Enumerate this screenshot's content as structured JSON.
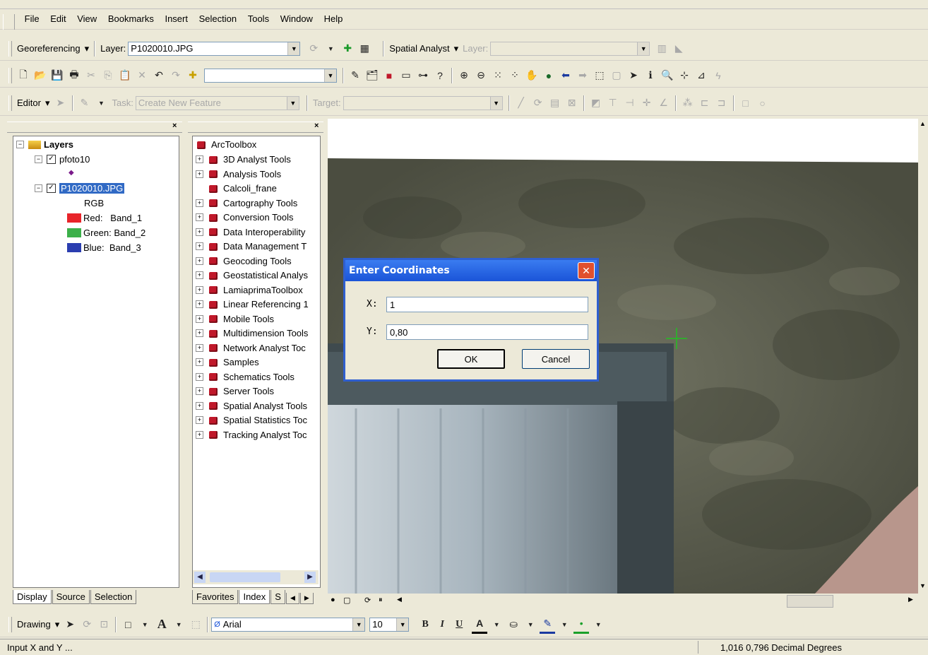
{
  "menu": [
    "File",
    "Edit",
    "View",
    "Bookmarks",
    "Insert",
    "Selection",
    "Tools",
    "Window",
    "Help"
  ],
  "georef_toolbar": {
    "georef_label": "Georeferencing",
    "layer_label": "Layer:",
    "layer_value": "P1020010.JPG",
    "spatial_label": "Spatial Analyst",
    "layer2_label": "Layer:"
  },
  "editor_toolbar": {
    "editor_label": "Editor",
    "task_label": "Task:",
    "task_value": "Create New Feature",
    "target_label": "Target:"
  },
  "toc": {
    "root": "Layers",
    "layer1": "pfoto10",
    "layer2": "P1020010.JPG",
    "rgb": "RGB",
    "red": "Red:   Band_1",
    "green": "Green: Band_2",
    "blue": "Blue:  Band_3",
    "colors": {
      "red": "#e8242a",
      "green": "#3cb04a",
      "blue": "#2b3eb0"
    },
    "tabs": [
      "Display",
      "Source",
      "Selection"
    ]
  },
  "toolbox": {
    "root": "ArcToolbox",
    "items": [
      "3D Analyst Tools",
      "Analysis Tools",
      "Calcoli_frane",
      "Cartography Tools",
      "Conversion Tools",
      "Data Interoperability",
      "Data Management T",
      "Geocoding Tools",
      "Geostatistical Analys",
      "LamiaprimaToolbox",
      "Linear Referencing 1",
      "Mobile Tools",
      "Multidimension Tools",
      "Network Analyst Toc",
      "Samples",
      "Schematics Tools",
      "Server Tools",
      "Spatial Analyst Tools",
      "Spatial Statistics Toc",
      "Tracking Analyst Toc"
    ],
    "tabs": [
      "Favorites",
      "Index",
      "S"
    ]
  },
  "dialog": {
    "title": "Enter Coordinates",
    "x_label": "X:",
    "x_value": "1",
    "y_label": "Y:",
    "y_value": "0,80",
    "ok": "OK",
    "cancel": "Cancel"
  },
  "drawing_toolbar": {
    "drawing_label": "Drawing",
    "font": "Arial",
    "size": "10"
  },
  "status": {
    "left": "Input X and Y ...",
    "right": "1,016  0,796 Decimal Degrees"
  }
}
